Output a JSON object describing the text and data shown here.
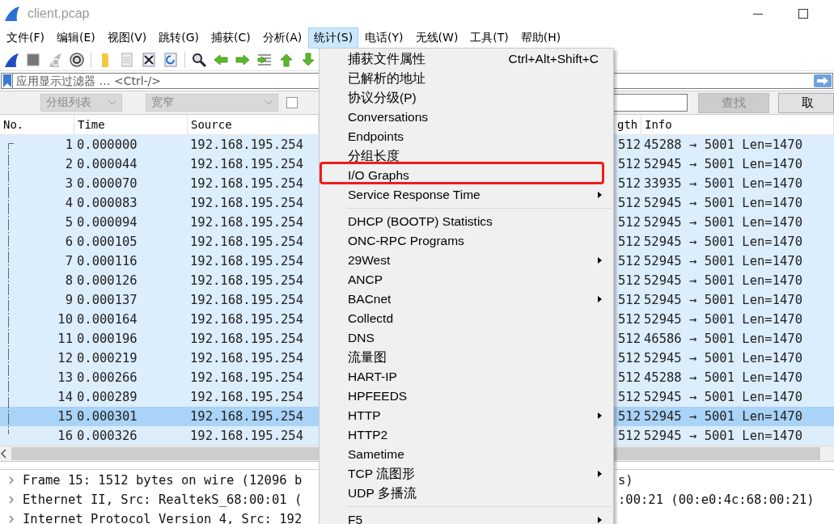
{
  "window": {
    "title": "client.pcap"
  },
  "menu_bar": [
    {
      "label": "文件(F)",
      "selected": false
    },
    {
      "label": "编辑(E)",
      "selected": false
    },
    {
      "label": "视图(V)",
      "selected": false
    },
    {
      "label": "跳转(G)",
      "selected": false
    },
    {
      "label": "捕获(C)",
      "selected": false
    },
    {
      "label": "分析(A)",
      "selected": false
    },
    {
      "label": "统计(S)",
      "selected": true
    },
    {
      "label": "电话(Y)",
      "selected": false
    },
    {
      "label": "无线(W)",
      "selected": false
    },
    {
      "label": "工具(T)",
      "selected": false
    },
    {
      "label": "帮助(H)",
      "selected": false
    }
  ],
  "filter_bar": {
    "placeholder": "应用显示过滤器 … <Ctrl-/>"
  },
  "find_bar": {
    "dropdowns": [
      {
        "value": "分组列表",
        "disabled": true
      },
      {
        "value": "宽窄",
        "disabled": true
      }
    ],
    "checkbox": {
      "checked": false
    },
    "buttons": [
      {
        "label": "查找",
        "disabled": true
      },
      {
        "label": "取",
        "disabled": false
      }
    ]
  },
  "packet_list": {
    "columns": [
      "No.",
      "Time",
      "Source",
      "",
      "gth",
      "Info"
    ],
    "rows": [
      {
        "no": "1",
        "time": "0.000000",
        "source": "192.168.195.254",
        "length": "512",
        "info": "45288 → 5001 Len=1470",
        "selected": false
      },
      {
        "no": "2",
        "time": "0.000044",
        "source": "192.168.195.254",
        "length": "512",
        "info": "52945 → 5001 Len=1470",
        "selected": false
      },
      {
        "no": "3",
        "time": "0.000070",
        "source": "192.168.195.254",
        "length": "512",
        "info": "33935 → 5001 Len=1470",
        "selected": false
      },
      {
        "no": "4",
        "time": "0.000083",
        "source": "192.168.195.254",
        "length": "512",
        "info": "52945 → 5001 Len=1470",
        "selected": false
      },
      {
        "no": "5",
        "time": "0.000094",
        "source": "192.168.195.254",
        "length": "512",
        "info": "52945 → 5001 Len=1470",
        "selected": false
      },
      {
        "no": "6",
        "time": "0.000105",
        "source": "192.168.195.254",
        "length": "512",
        "info": "52945 → 5001 Len=1470",
        "selected": false
      },
      {
        "no": "7",
        "time": "0.000116",
        "source": "192.168.195.254",
        "length": "512",
        "info": "52945 → 5001 Len=1470",
        "selected": false
      },
      {
        "no": "8",
        "time": "0.000126",
        "source": "192.168.195.254",
        "length": "512",
        "info": "52945 → 5001 Len=1470",
        "selected": false
      },
      {
        "no": "9",
        "time": "0.000137",
        "source": "192.168.195.254",
        "length": "512",
        "info": "52945 → 5001 Len=1470",
        "selected": false
      },
      {
        "no": "10",
        "time": "0.000164",
        "source": "192.168.195.254",
        "length": "512",
        "info": "52945 → 5001 Len=1470",
        "selected": false
      },
      {
        "no": "11",
        "time": "0.000196",
        "source": "192.168.195.254",
        "length": "512",
        "info": "46586 → 5001 Len=1470",
        "selected": false
      },
      {
        "no": "12",
        "time": "0.000219",
        "source": "192.168.195.254",
        "length": "512",
        "info": "52945 → 5001 Len=1470",
        "selected": false
      },
      {
        "no": "13",
        "time": "0.000266",
        "source": "192.168.195.254",
        "length": "512",
        "info": "45288 → 5001 Len=1470",
        "selected": false
      },
      {
        "no": "14",
        "time": "0.000289",
        "source": "192.168.195.254",
        "length": "512",
        "info": "52945 → 5001 Len=1470",
        "selected": false
      },
      {
        "no": "15",
        "time": "0.000301",
        "source": "192.168.195.254",
        "length": "512",
        "info": "52945 → 5001 Len=1470",
        "selected": true
      },
      {
        "no": "16",
        "time": "0.000326",
        "source": "192.168.195.254",
        "length": "512",
        "info": "52945 → 5001 Len=1470",
        "selected": false
      }
    ]
  },
  "details": [
    {
      "text": "Frame 15: 1512 bytes on wire (12096 b",
      "right_text": "s)",
      "expanded": false
    },
    {
      "text": "Ethernet II, Src: RealtekS_68:00:01 (",
      "right_text": ":00:21 (00:e0:4c:68:00:21)",
      "expanded": false
    },
    {
      "text": "Internet Protocol Version 4, Src: 192",
      "expanded": false
    }
  ],
  "statistics_menu": [
    {
      "kind": "item",
      "label": "捕获文件属性",
      "shortcut": "Ctrl+Alt+Shift+C",
      "submenu": false,
      "annotated": false
    },
    {
      "kind": "item",
      "label": "已解析的地址",
      "submenu": false,
      "annotated": false
    },
    {
      "kind": "item",
      "label": "协议分级(P)",
      "submenu": false,
      "annotated": false
    },
    {
      "kind": "item",
      "label": "Conversations",
      "submenu": false,
      "annotated": false
    },
    {
      "kind": "item",
      "label": "Endpoints",
      "submenu": false,
      "annotated": false
    },
    {
      "kind": "item",
      "label": "分组长度",
      "submenu": false,
      "annotated": false
    },
    {
      "kind": "item",
      "label": "I/O Graphs",
      "submenu": false,
      "annotated": true
    },
    {
      "kind": "item",
      "label": "Service Response Time",
      "submenu": true,
      "annotated": false
    },
    {
      "kind": "separator"
    },
    {
      "kind": "item",
      "label": "DHCP (BOOTP) Statistics",
      "submenu": false,
      "annotated": false
    },
    {
      "kind": "item",
      "label": "ONC-RPC Programs",
      "submenu": false,
      "annotated": false
    },
    {
      "kind": "item",
      "label": "29West",
      "submenu": true,
      "annotated": false
    },
    {
      "kind": "item",
      "label": "ANCP",
      "submenu": false,
      "annotated": false
    },
    {
      "kind": "item",
      "label": "BACnet",
      "submenu": true,
      "annotated": false
    },
    {
      "kind": "item",
      "label": "Collectd",
      "submenu": false,
      "annotated": false
    },
    {
      "kind": "item",
      "label": "DNS",
      "submenu": false,
      "annotated": false
    },
    {
      "kind": "item",
      "label": "流量图",
      "submenu": false,
      "annotated": false
    },
    {
      "kind": "item",
      "label": "HART-IP",
      "submenu": false,
      "annotated": false
    },
    {
      "kind": "item",
      "label": "HPFEEDS",
      "submenu": false,
      "annotated": false
    },
    {
      "kind": "item",
      "label": "HTTP",
      "submenu": true,
      "annotated": false
    },
    {
      "kind": "item",
      "label": "HTTP2",
      "submenu": false,
      "annotated": false
    },
    {
      "kind": "item",
      "label": "Sametime",
      "submenu": false,
      "annotated": false
    },
    {
      "kind": "item",
      "label": "TCP 流图形",
      "submenu": true,
      "annotated": false
    },
    {
      "kind": "item",
      "label": "UDP 多播流",
      "submenu": false,
      "annotated": false
    },
    {
      "kind": "separator"
    },
    {
      "kind": "item",
      "label": "F5",
      "submenu": true,
      "annotated": false
    }
  ]
}
